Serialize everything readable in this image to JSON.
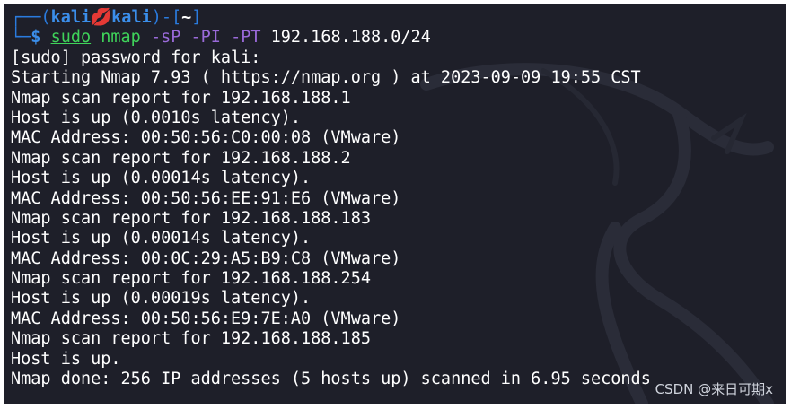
{
  "prompt": {
    "corner_top": "┌──(",
    "user": "kali",
    "skull": "💋",
    "host": "kali",
    "mid": ")-[",
    "dir": "~",
    "end": "]",
    "corner_bottom": "└─",
    "dollar": "$ ",
    "cmd_sudo": "sudo",
    "cmd_nmap": " nmap ",
    "opt_sP": "-sP",
    "opt_PI": " -PI",
    "opt_PT": " -PT",
    "target": " 192.168.188.0/24"
  },
  "output_lines": [
    "[sudo] password for kali:",
    "Starting Nmap 7.93 ( https://nmap.org ) at 2023-09-09 19:55 CST",
    "Nmap scan report for 192.168.188.1",
    "Host is up (0.0010s latency).",
    "MAC Address: 00:50:56:C0:00:08 (VMware)",
    "Nmap scan report for 192.168.188.2",
    "Host is up (0.00014s latency).",
    "MAC Address: 00:50:56:EE:91:E6 (VMware)",
    "Nmap scan report for 192.168.188.183",
    "Host is up (0.00014s latency).",
    "MAC Address: 00:0C:29:A5:B9:C8 (VMware)",
    "Nmap scan report for 192.168.188.254",
    "Host is up (0.00019s latency).",
    "MAC Address: 00:50:56:E9:7E:A0 (VMware)",
    "Nmap scan report for 192.168.188.185",
    "Host is up.",
    "Nmap done: 256 IP addresses (5 hosts up) scanned in 6.95 seconds"
  ],
  "watermark": "CSDN @来日可期x",
  "colors": {
    "background": "#1e1f29",
    "prompt_blue": "#2a7bde",
    "command_green": "#3fd35a",
    "option_purple": "#9a6ad9",
    "skull_red": "#e83a3a"
  },
  "background_icon": "kali-dragon-icon"
}
